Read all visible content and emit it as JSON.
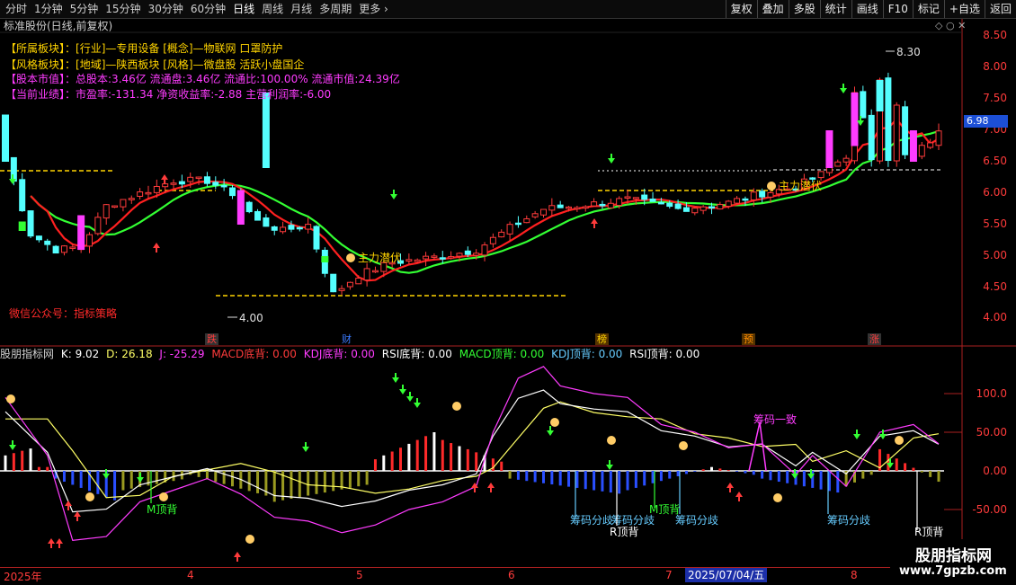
{
  "toolbar": {
    "periods": [
      "分时",
      "1分钟",
      "5分钟",
      "15分钟",
      "30分钟",
      "60分钟",
      "日线",
      "周线",
      "月线",
      "多周期",
      "更多 ›"
    ],
    "active_period": "日线",
    "buttons": [
      "复权",
      "叠加",
      "多股",
      "统计",
      "画线",
      "F10",
      "标记",
      "+自选",
      "返回"
    ]
  },
  "chart_title": "标准股份(日线,前复权)",
  "info": [
    {
      "label": "【所属板块】：",
      "value": "[行业]—专用设备 [概念]—物联网 口罩防护",
      "color": "yellow"
    },
    {
      "label": "【风格板块】：",
      "value": "[地域]—陕西板块 [风格]—微盘股 活跃小盘国企",
      "color": "yellow"
    },
    {
      "label": "【股本市值】：",
      "value": "总股本:3.46亿 流通盘:3.46亿 流通比:100.00% 流通市值:24.39亿",
      "color": "pink"
    },
    {
      "label": "【当前业绩】：",
      "value": "市盈率:-131.34 净资收益率:-2.88 主营利润率:-6.00",
      "color": "pink"
    }
  ],
  "watermark": "微信公众号：指标策略",
  "price_axis": [
    "8.50",
    "8.00",
    "7.50",
    "7.00",
    "6.50",
    "6.00",
    "5.50",
    "5.00",
    "4.50",
    "4.00"
  ],
  "current_price": "6.98",
  "high_label": "8.30",
  "low_label": "4.00",
  "annotations": {
    "zl1": "主力潜伏",
    "zl2": "主力潜伏"
  },
  "events": [
    {
      "text": "跌",
      "color": "#ff3b3b",
      "bg": "#333"
    },
    {
      "text": "财",
      "color": "#3b7bff",
      "bg": "#000"
    },
    {
      "text": "榜",
      "color": "#ffd400",
      "bg": "#553300"
    },
    {
      "text": "预",
      "color": "#ff8c00",
      "bg": "#553300"
    },
    {
      "text": "涨",
      "color": "#ff3b3b",
      "bg": "#333"
    }
  ],
  "indicator_header": [
    {
      "text": "股朋指标网",
      "color": "#cfcfcf"
    },
    {
      "text": "K: 9.02",
      "color": "#ffffff"
    },
    {
      "text": "D: 26.18",
      "color": "#ffff66"
    },
    {
      "text": "J: -25.29",
      "color": "#ff3cff"
    },
    {
      "text": "MACD底背: 0.00",
      "color": "#ff3b3b"
    },
    {
      "text": "KDJ底背: 0.00",
      "color": "#ff3cff"
    },
    {
      "text": "RSI底背: 0.00",
      "color": "#ffffff"
    },
    {
      "text": "MACD顶背: 0.00",
      "color": "#33ff33"
    },
    {
      "text": "KDJ顶背: 0.00",
      "color": "#66ccff"
    },
    {
      "text": "RSI顶背: 0.00",
      "color": "#ffffff"
    }
  ],
  "ind_axis": [
    "100.0",
    "50.00",
    "0.00",
    "-50.00"
  ],
  "ind_labels": {
    "m_top1": "M顶背",
    "m_top2": "M顶背",
    "cm1": "筹码分歧",
    "cm2": "筹码分歧",
    "cm3": "筹码分歧",
    "cm4": "筹码分歧",
    "cm_yz": "筹码一致",
    "r_top1": "R顶背",
    "r_top2": "R顶背"
  },
  "dates": [
    "2025年",
    "4",
    "5",
    "6",
    "7",
    "8"
  ],
  "date_cursor": "2025/07/04/五",
  "logo": {
    "name": "股朋指标网",
    "url": "www.7gpzb.com"
  },
  "colors": {
    "up": "#ff3b3b",
    "down": "#54ffff",
    "ma_red": "#ff2020",
    "ma_green": "#33ff33",
    "yellow": "#ffd400",
    "magenta": "#ff3cff"
  }
}
